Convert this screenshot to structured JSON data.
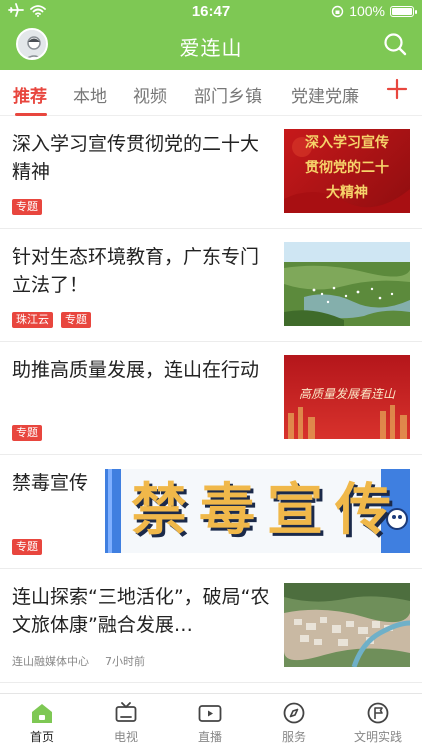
{
  "status_bar": {
    "time": "16:47",
    "battery": "100%"
  },
  "header": {
    "title": "爱连山"
  },
  "tabs": [
    {
      "label": "推荐",
      "active": true
    },
    {
      "label": "本地"
    },
    {
      "label": "视频"
    },
    {
      "label": "部门乡镇"
    },
    {
      "label": "党建党廉"
    }
  ],
  "feed": [
    {
      "headline": "深入学习宣传贯彻党的二十大精神",
      "tags": [
        "专题"
      ],
      "thumb_text": "深入学习宣传贯彻党的二十大精神"
    },
    {
      "headline": "针对生态环境教育，广东专门立法了！",
      "tags": [
        "珠江云",
        "专题"
      ]
    },
    {
      "headline": "助推高质量发展，连山在行动",
      "tags": [
        "专题"
      ],
      "thumb_text": "高质量发展看连山"
    },
    {
      "headline": "禁毒宣传",
      "tags": [
        "专题"
      ],
      "banner_text": "禁毒宣传"
    },
    {
      "headline": "连山探索“三地活化”，破局“农文旅体康”融合发展…",
      "source": "连山融媒体中心",
      "time": "7小时前"
    }
  ],
  "bottom_nav": [
    {
      "label": "首页",
      "icon": "home-icon",
      "active": true
    },
    {
      "label": "电视",
      "icon": "tv-icon"
    },
    {
      "label": "直播",
      "icon": "live-icon"
    },
    {
      "label": "服务",
      "icon": "compass-icon"
    },
    {
      "label": "文明实践",
      "icon": "flag-icon"
    }
  ],
  "colors": {
    "brand_green": "#7ec854",
    "accent_red": "#e8463e"
  }
}
